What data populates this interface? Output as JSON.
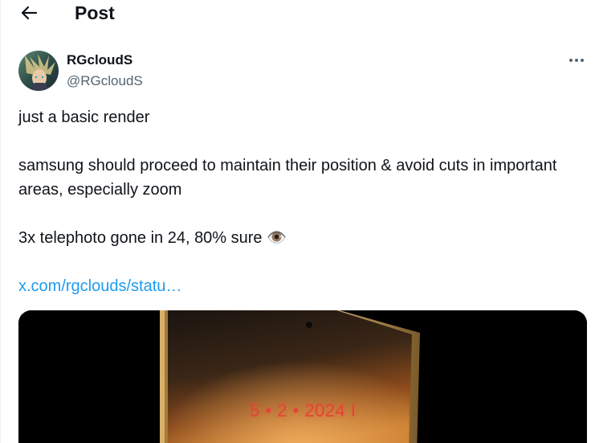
{
  "header": {
    "title": "Post",
    "back_icon": "arrow-left-icon"
  },
  "author": {
    "display_name": "RGcloudS",
    "handle": "@RGcloudS",
    "more_icon": "more-horizontal-icon"
  },
  "tweet": {
    "line1": "just a basic render",
    "line2": "samsung should proceed to maintain their position & avoid cuts in important areas, especially zoom",
    "line3": "3x telephoto gone in 24, 80% sure",
    "line3_emoji": "👁️",
    "link": "x.com/rgclouds/statu…"
  },
  "media": {
    "date_text": "5 • 2 • 2024 I"
  },
  "colors": {
    "link": "#1d9bf0",
    "secondary_text": "#536471",
    "primary_text": "#0f1419"
  }
}
